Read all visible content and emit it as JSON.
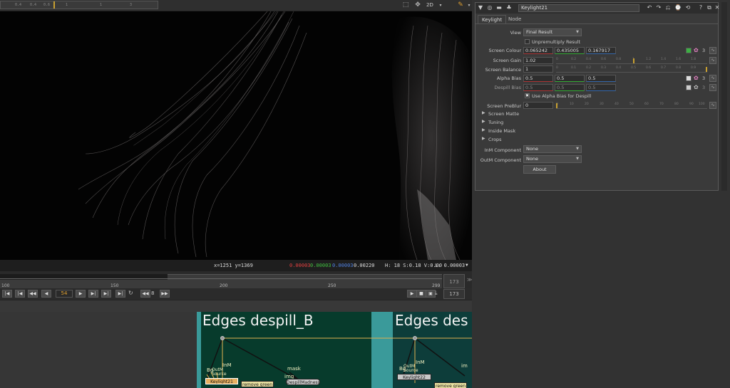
{
  "viewer": {
    "ruler_labels": [
      "0.4",
      "0.4",
      "0.6",
      "1",
      "1",
      "3"
    ],
    "mode": "2D",
    "info": {
      "coords": "x=1251 y=1369",
      "r": "0.00003",
      "g": "0.00003",
      "b": "0.00003",
      "a": "0.00220",
      "hsv": "H: 18 S:0.18 V:0.00",
      "lum": "L: 0.00003"
    }
  },
  "timeline": {
    "ticks": [
      "100",
      "150",
      "200",
      "250",
      "299"
    ],
    "end_frame": "173",
    "current_frame": "54",
    "increment": "8",
    "end_frame_field": "173"
  },
  "properties": {
    "node_name": "Keylight21",
    "tabs": [
      "Keylight",
      "Node"
    ],
    "view_label": "View",
    "view_value": "Final Result",
    "unpremultiply_label": "Unpremultiply Result",
    "screen_colour_label": "Screen Colour",
    "screen_colour": [
      "0.065242",
      "0.435005",
      "0.167917"
    ],
    "screen_gain_label": "Screen Gain",
    "screen_gain": "1.02",
    "screen_balance_label": "Screen Balance",
    "screen_balance": "1",
    "alpha_bias_label": "Alpha Bias",
    "alpha_bias": [
      "0.5",
      "0.5",
      "0.5"
    ],
    "despill_bias_label": "Despill Bias",
    "despill_bias": [
      "0.5",
      "0.5",
      "0.5"
    ],
    "use_alpha_bias_label": "Use Alpha Bias for Despill",
    "screen_preblur_label": "Screen PreBlur",
    "screen_preblur": "0",
    "channel_count": "3",
    "sections": [
      "Screen Matte",
      "Tuning",
      "Inside Mask",
      "Crops"
    ],
    "inm_component_label": "InM Component",
    "inm_component": "None",
    "outm_component_label": "OutM Component",
    "outm_component": "None",
    "about_label": "About",
    "gain_ticks": [
      "0",
      "0.2",
      "0.4",
      "0.6",
      "0.8",
      "1",
      "1.2",
      "1.4",
      "1.6",
      "1.8"
    ],
    "balance_ticks": [
      "0",
      "0.1",
      "0.2",
      "0.3",
      "0.4",
      "0.5",
      "0.6",
      "0.7",
      "0.8",
      "0.9"
    ],
    "preblur_ticks": [
      "0",
      "10",
      "20",
      "30",
      "40",
      "50",
      "60",
      "70",
      "80",
      "90",
      "100"
    ]
  },
  "nodegraph": {
    "backdrop1_title": "Edges despill_B",
    "backdrop2_title": "Edges des",
    "nodes": {
      "keylight21": "Keylight21",
      "keylight22": "Keylight22",
      "remove_green_1": "remove green",
      "remove_green_2": "remove green",
      "despill": "DespillMadness"
    },
    "labels": {
      "bg": "Bg",
      "inm": "InM",
      "outm_source": "OutM\nSource",
      "mask": "mask",
      "img": "img",
      "bg2": "Bg",
      "inm2": "InM",
      "outm_source2": "OutM\nSource",
      "img2": "im"
    }
  },
  "colors": {
    "screen_swatch": "#3cb043",
    "backdrop1": "#073b2c",
    "backdrop_edge": "#3a9a9a",
    "backdrop2": "#0d3d3a",
    "node_keylight": "#e8b060",
    "node_remove_green": "#e8e0a0",
    "node_despill": "#d0d0d0",
    "wire": "#e0b050"
  }
}
